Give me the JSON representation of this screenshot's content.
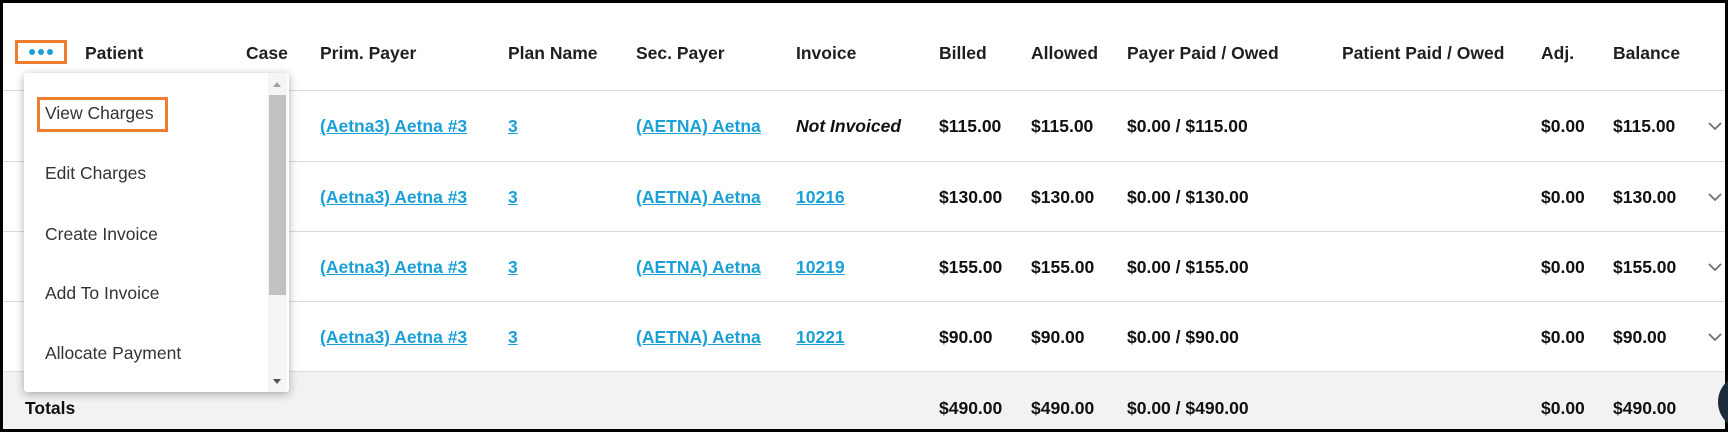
{
  "icons": {
    "more_options": "more-options-icon",
    "row_expand": "chevron-down-icon",
    "scroll_up": "scroll-up-arrow-icon",
    "scroll_down": "scroll-down-arrow-icon",
    "chat_widget": "chat-widget-icon"
  },
  "colors": {
    "link": "#1a9fd6",
    "highlight_outline": "#ee7d31",
    "totals_background": "#f2f2f2",
    "row_divider": "#dcdcdc",
    "text": "#111111"
  },
  "table": {
    "headers": {
      "patient": "Patient",
      "case": "Case",
      "prim_payer": "Prim. Payer",
      "plan_name": "Plan Name",
      "sec_payer": "Sec. Payer",
      "invoice": "Invoice",
      "billed": "Billed",
      "allowed": "Allowed",
      "payer_paid_owed": "Payer Paid / Owed",
      "patient_paid_owed": "Patient Paid / Owed",
      "adj": "Adj.",
      "balance": "Balance"
    },
    "rows": [
      {
        "prim_payer": "(Aetna3) Aetna #3",
        "plan_name": "3",
        "sec_payer": "(AETNA) Aetna",
        "invoice": "Not Invoiced",
        "invoice_linked": false,
        "billed": "$115.00",
        "allowed": "$115.00",
        "payer_paid_owed": "$0.00 / $115.00",
        "adj": "$0.00",
        "balance": "$115.00"
      },
      {
        "prim_payer": "(Aetna3) Aetna #3",
        "plan_name": "3",
        "sec_payer": "(AETNA) Aetna",
        "invoice": "10216",
        "invoice_linked": true,
        "billed": "$130.00",
        "allowed": "$130.00",
        "payer_paid_owed": "$0.00 / $130.00",
        "adj": "$0.00",
        "balance": "$130.00"
      },
      {
        "prim_payer": "(Aetna3) Aetna #3",
        "plan_name": "3",
        "sec_payer": "(AETNA) Aetna",
        "invoice": "10219",
        "invoice_linked": true,
        "billed": "$155.00",
        "allowed": "$155.00",
        "payer_paid_owed": "$0.00 / $155.00",
        "adj": "$0.00",
        "balance": "$155.00"
      },
      {
        "prim_payer": "(Aetna3) Aetna #3",
        "plan_name": "3",
        "sec_payer": "(AETNA) Aetna",
        "invoice": "10221",
        "invoice_linked": true,
        "billed": "$90.00",
        "allowed": "$90.00",
        "payer_paid_owed": "$0.00 / $90.00",
        "adj": "$0.00",
        "balance": "$90.00"
      }
    ],
    "totals": {
      "label": "Totals",
      "billed": "$490.00",
      "allowed": "$490.00",
      "payer_paid_owed": "$0.00 / $490.00",
      "adj": "$0.00",
      "balance": "$490.00"
    }
  },
  "actions_menu": {
    "items": [
      "View Charges",
      "Edit Charges",
      "Create Invoice",
      "Add To Invoice",
      "Allocate Payment"
    ],
    "highlighted_index": 0
  }
}
